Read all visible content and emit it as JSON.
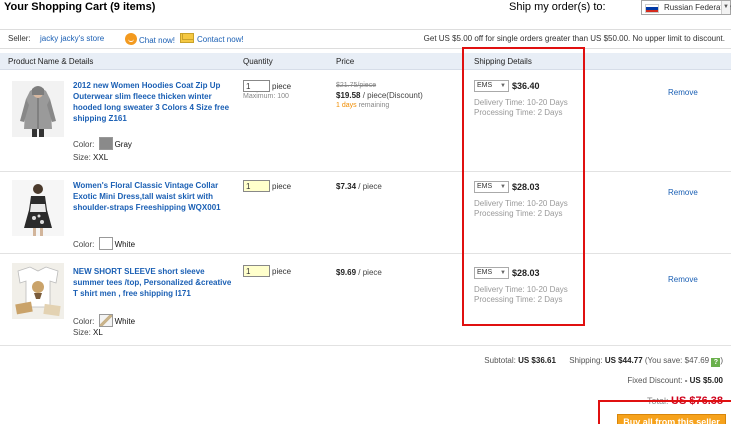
{
  "header": {
    "title": "Your Shopping Cart (9 items)",
    "ship_label": "Ship my order(s) to:",
    "country": "Russian Federation",
    "flag_colors": [
      "#ffffff",
      "#0039a6",
      "#d52b1e"
    ]
  },
  "seller": {
    "label": "Seller:",
    "store": "jacky jacky's store",
    "chat": "Chat now!",
    "contact": "Contact now!",
    "promo": "Get US $5.00 off for single orders greater than US $50.00. No upper limit to discount."
  },
  "table": {
    "headers": {
      "product": "Product Name & Details",
      "quantity": "Quantity",
      "price": "Price",
      "shipping": "Shipping Details"
    },
    "items": [
      {
        "title": "2012 new Women Hoodies Coat Zip Up Outerwear slim fleece thicken winter hooded long sweater 3 Colors 4 Size free shipping Z161",
        "color_label": "Color:",
        "color": "Gray",
        "size_label": "Size:",
        "size": "XXL",
        "qty": "1",
        "unit": "piece",
        "max": "Maximum: 100",
        "old_price": "$21.75/piece",
        "price": "$19.58",
        "price_suffix": "/ piece(Discount)",
        "days": "1 days",
        "days_suffix": "remaining",
        "ship_method": "EMS",
        "ship_cost": "$36.40",
        "delivery": "Delivery Time:  10-20 Days",
        "processing": "Processing Time:  2 Days",
        "remove": "Remove"
      },
      {
        "title": "Women's Floral Classic Vintage Collar Exotic Mini Dress,tall waist skirt with shoulder-straps Freeshipping WQX001",
        "color_label": "Color:",
        "color": "White",
        "qty": "1",
        "unit": "piece",
        "price": "$7.34",
        "price_suffix": "/ piece",
        "ship_method": "EMS",
        "ship_cost": "$28.03",
        "delivery": "Delivery Time:  10-20 Days",
        "processing": "Processing Time:  2 Days",
        "remove": "Remove"
      },
      {
        "title": "NEW SHORT SLEEVE short sleeve summer tees /top, Personalized &creative T shirt men , free shipping l171",
        "color_label": "Color:",
        "color": "White",
        "size_label": "Size:",
        "size": "XL",
        "qty": "1",
        "unit": "piece",
        "price": "$9.69",
        "price_suffix": "/ piece",
        "ship_method": "EMS",
        "ship_cost": "$28.03",
        "delivery": "Delivery Time:  10-20 Days",
        "processing": "Processing Time:  2 Days",
        "remove": "Remove"
      }
    ]
  },
  "summary": {
    "subtotal_label": "Subtotal:",
    "subtotal": "US $36.61",
    "shipping_label": "Shipping:",
    "shipping": "US $44.77",
    "save_text": "(You save: $47.69",
    "save_icon": "?",
    "save_close": ")",
    "discount_label": "Fixed Discount:",
    "discount": "- US $5.00",
    "total_label": "Total:",
    "total": "US $76.38",
    "buy_button": "Buy all from this seller"
  }
}
